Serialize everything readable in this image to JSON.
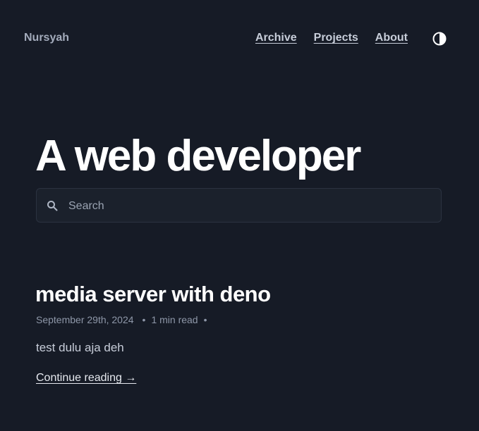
{
  "header": {
    "site_name": "Nursyah",
    "nav": [
      {
        "label": "Archive"
      },
      {
        "label": "Projects"
      },
      {
        "label": "About"
      }
    ],
    "theme_toggle_icon": "contrast-icon"
  },
  "hero": {
    "title": "A web developer"
  },
  "search": {
    "placeholder": "Search",
    "value": "",
    "icon": "search-icon"
  },
  "posts": [
    {
      "title": "media server with deno",
      "date": "September 29th, 2024",
      "read_time": "1 min read",
      "excerpt": "test dulu aja deh",
      "link_label": "Continue reading →"
    }
  ],
  "colors": {
    "background": "#161b26",
    "text": "#e6e9ef",
    "muted": "#8e97a8"
  }
}
